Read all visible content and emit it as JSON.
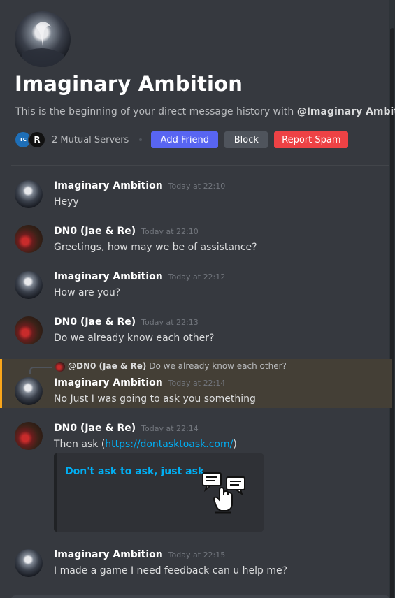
{
  "header": {
    "title": "Imaginary Ambition",
    "subtitle_prefix": "This is the beginning of your direct message history with ",
    "subtitle_handle": "@Imaginary Ambition",
    "subtitle_suffix": ".",
    "mutual_servers": "2 Mutual Servers",
    "server_icons": [
      "TC",
      "R"
    ],
    "buttons": {
      "add_friend": "Add Friend",
      "block": "Block",
      "report_spam": "Report Spam"
    }
  },
  "messages": [
    {
      "author": "Imaginary Ambition",
      "timestamp": "Today at 22:10",
      "text": "Heyy"
    },
    {
      "author": "DN0 (Jae & Re)",
      "timestamp": "Today at 22:10",
      "text": "Greetings, how may we be of assistance?"
    },
    {
      "author": "Imaginary Ambition",
      "timestamp": "Today at 22:12",
      "text": "How are you?"
    },
    {
      "author": "DN0 (Jae & Re)",
      "timestamp": "Today at 22:13",
      "text": "Do we already know each other?"
    },
    {
      "author": "Imaginary Ambition",
      "timestamp": "Today at 22:14",
      "text": "No Just I was going to ask you something",
      "reply": {
        "author": "@DN0 (Jae & Re)",
        "text": "Do we already know each other?"
      }
    },
    {
      "author": "DN0 (Jae & Re)",
      "timestamp": "Today at 22:14",
      "text_prefix": "Then ask (",
      "link": "https://dontasktoask.com/",
      "text_suffix": ")",
      "embed_title": "Don't ask to ask, just ask"
    },
    {
      "author": "Imaginary Ambition",
      "timestamp": "Today at 22:15",
      "text": "I made a game I need feedback can u help me?"
    }
  ],
  "colors": {
    "background": "#36393f",
    "blurple": "#5865f2",
    "danger": "#ed4245",
    "highlight": "#443f36",
    "mention_bar": "#faa61a",
    "link": "#00aff4"
  }
}
